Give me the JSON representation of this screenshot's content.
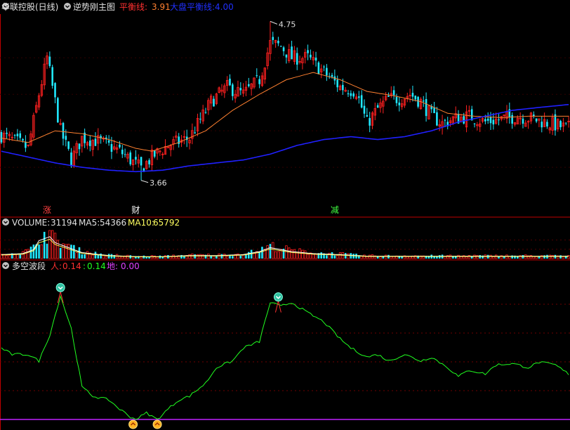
{
  "main_header": {
    "stock": "华联控股(日线)",
    "indicator": "逆势刚主图",
    "balance_label": "平衡线:",
    "balance_value": "3.91",
    "market_balance_label": "大盘平衡线:",
    "market_balance_value": "4.00"
  },
  "volume_header": {
    "volume_label": "VOLUME:",
    "volume_value": "31194",
    "ma5_label": "MA5:",
    "ma5_value": "54366",
    "ma10_label": "MA10:",
    "ma10_value": "65792"
  },
  "osc_header": {
    "title": "多空波段",
    "ren_label": "人:",
    "ren_value": "0.14",
    "b_label": ":",
    "b_value": "0.14",
    "di_label": "地:",
    "di_value": "0.00"
  },
  "markers": [
    {
      "text": "涨",
      "index": 17,
      "color": "#ff4040"
    },
    {
      "text": "财",
      "index": 50,
      "color": "#ffffff"
    },
    {
      "text": "减",
      "index": 124,
      "color": "#40ff40"
    }
  ],
  "colors": {
    "up": "#ff2020",
    "down": "#20e8ff",
    "ma_orange": "#ff8030",
    "ma_blue": "#2020ff",
    "osc_green": "#20ff20",
    "osc_purple": "#c020ff",
    "grid_red": "#a00000",
    "vol_ma5": "#ffffff",
    "vol_ma10": "#ffff60",
    "label_white": "#e0e0e0"
  },
  "chart_data": [
    {
      "type": "candlestick",
      "name": "price",
      "high_label": "4.75",
      "low_label": "3.66",
      "ylim": [
        3.5,
        4.8
      ],
      "high_point": {
        "index": 100,
        "value": 4.75
      },
      "low_point": {
        "index": 52,
        "value": 3.66
      },
      "anchors": [
        [
          0,
          3.97
        ],
        [
          6,
          3.92
        ],
        [
          10,
          3.88
        ],
        [
          14,
          4.25
        ],
        [
          17,
          4.5
        ],
        [
          22,
          4.0
        ],
        [
          26,
          3.8
        ],
        [
          30,
          3.95
        ],
        [
          36,
          3.93
        ],
        [
          44,
          3.86
        ],
        [
          48,
          3.8
        ],
        [
          52,
          3.74
        ],
        [
          56,
          3.82
        ],
        [
          62,
          3.9
        ],
        [
          70,
          3.95
        ],
        [
          78,
          4.2
        ],
        [
          84,
          4.3
        ],
        [
          90,
          4.25
        ],
        [
          96,
          4.35
        ],
        [
          100,
          4.6
        ],
        [
          104,
          4.58
        ],
        [
          108,
          4.5
        ],
        [
          114,
          4.5
        ],
        [
          120,
          4.4
        ],
        [
          126,
          4.3
        ],
        [
          132,
          4.27
        ],
        [
          136,
          4.05
        ],
        [
          140,
          4.15
        ],
        [
          144,
          4.22
        ],
        [
          148,
          4.22
        ],
        [
          152,
          4.25
        ],
        [
          156,
          4.2
        ],
        [
          160,
          4.1
        ],
        [
          164,
          4.05
        ],
        [
          168,
          4.08
        ],
        [
          174,
          4.1
        ],
        [
          180,
          4.06
        ],
        [
          186,
          4.08
        ],
        [
          192,
          4.1
        ],
        [
          198,
          4.08
        ],
        [
          204,
          4.05
        ],
        [
          210,
          4.02
        ]
      ],
      "ma_orange_anchors": [
        [
          0,
          3.95
        ],
        [
          10,
          3.92
        ],
        [
          20,
          4.0
        ],
        [
          30,
          3.98
        ],
        [
          40,
          3.94
        ],
        [
          50,
          3.88
        ],
        [
          56,
          3.86
        ],
        [
          66,
          3.92
        ],
        [
          76,
          4.0
        ],
        [
          86,
          4.14
        ],
        [
          96,
          4.25
        ],
        [
          106,
          4.35
        ],
        [
          116,
          4.4
        ],
        [
          126,
          4.35
        ],
        [
          136,
          4.27
        ],
        [
          146,
          4.24
        ],
        [
          156,
          4.2
        ],
        [
          166,
          4.12
        ],
        [
          176,
          4.1
        ],
        [
          186,
          4.09
        ],
        [
          196,
          4.1
        ],
        [
          206,
          4.1
        ],
        [
          211,
          4.1
        ]
      ],
      "ma_blue_anchors": [
        [
          0,
          3.86
        ],
        [
          10,
          3.82
        ],
        [
          20,
          3.78
        ],
        [
          30,
          3.75
        ],
        [
          40,
          3.73
        ],
        [
          50,
          3.72
        ],
        [
          60,
          3.73
        ],
        [
          70,
          3.76
        ],
        [
          80,
          3.78
        ],
        [
          90,
          3.8
        ],
        [
          100,
          3.84
        ],
        [
          110,
          3.9
        ],
        [
          120,
          3.94
        ],
        [
          130,
          3.96
        ],
        [
          140,
          3.94
        ],
        [
          150,
          3.96
        ],
        [
          160,
          4.0
        ],
        [
          170,
          4.06
        ],
        [
          180,
          4.1
        ],
        [
          190,
          4.14
        ],
        [
          200,
          4.16
        ],
        [
          211,
          4.18
        ]
      ]
    },
    {
      "type": "bar",
      "name": "volume",
      "anchors": [
        [
          0,
          20
        ],
        [
          8,
          25
        ],
        [
          12,
          45
        ],
        [
          14,
          90
        ],
        [
          18,
          110
        ],
        [
          20,
          80
        ],
        [
          24,
          60
        ],
        [
          30,
          30
        ],
        [
          40,
          15
        ],
        [
          50,
          10
        ],
        [
          60,
          10
        ],
        [
          70,
          15
        ],
        [
          80,
          15
        ],
        [
          90,
          20
        ],
        [
          96,
          35
        ],
        [
          100,
          55
        ],
        [
          104,
          45
        ],
        [
          108,
          35
        ],
        [
          116,
          25
        ],
        [
          126,
          20
        ],
        [
          136,
          12
        ],
        [
          150,
          12
        ],
        [
          170,
          12
        ],
        [
          190,
          12
        ],
        [
          211,
          12
        ]
      ],
      "ylim": [
        0,
        120
      ]
    },
    {
      "type": "line",
      "name": "多空波段",
      "ylim": [
        0,
        100
      ],
      "anchors": [
        [
          0,
          55
        ],
        [
          4,
          50
        ],
        [
          10,
          50
        ],
        [
          14,
          45
        ],
        [
          18,
          65
        ],
        [
          22,
          95
        ],
        [
          26,
          70
        ],
        [
          30,
          25
        ],
        [
          34,
          18
        ],
        [
          40,
          15
        ],
        [
          44,
          8
        ],
        [
          48,
          2
        ],
        [
          50,
          0
        ],
        [
          54,
          5
        ],
        [
          58,
          0
        ],
        [
          62,
          8
        ],
        [
          66,
          15
        ],
        [
          70,
          18
        ],
        [
          76,
          28
        ],
        [
          80,
          40
        ],
        [
          86,
          45
        ],
        [
          90,
          55
        ],
        [
          96,
          60
        ],
        [
          100,
          90
        ],
        [
          104,
          87
        ],
        [
          108,
          90
        ],
        [
          114,
          82
        ],
        [
          120,
          75
        ],
        [
          126,
          62
        ],
        [
          130,
          55
        ],
        [
          136,
          48
        ],
        [
          140,
          50
        ],
        [
          144,
          45
        ],
        [
          150,
          50
        ],
        [
          156,
          45
        ],
        [
          160,
          48
        ],
        [
          166,
          40
        ],
        [
          170,
          33
        ],
        [
          174,
          38
        ],
        [
          180,
          35
        ],
        [
          184,
          42
        ],
        [
          190,
          43
        ],
        [
          196,
          40
        ],
        [
          200,
          44
        ],
        [
          206,
          42
        ],
        [
          211,
          35
        ]
      ],
      "top_signals": [
        22,
        103
      ],
      "bottom_signals": [
        49,
        58
      ]
    }
  ]
}
